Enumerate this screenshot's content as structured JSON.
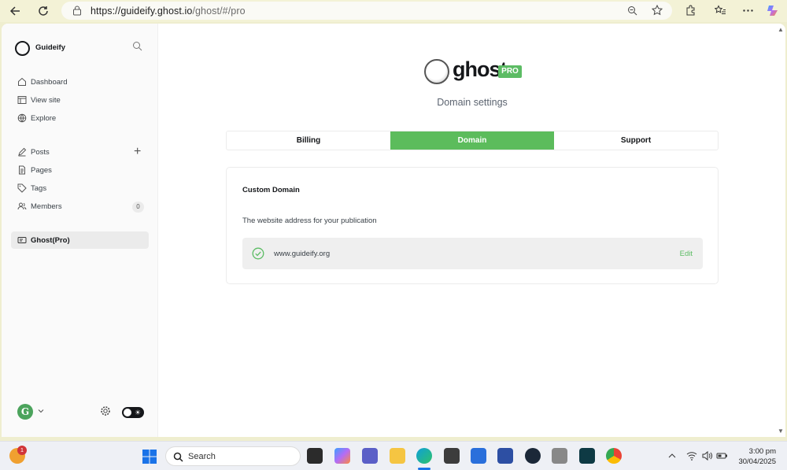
{
  "browser": {
    "url_host": "https://guideify.ghost.io",
    "url_path": "/ghost/#/pro"
  },
  "sidebar": {
    "site_name": "Guideify",
    "nav": [
      {
        "label": "Dashboard",
        "icon": "home-icon"
      },
      {
        "label": "View site",
        "icon": "layout-icon"
      },
      {
        "label": "Explore",
        "icon": "globe-icon"
      }
    ],
    "content": [
      {
        "label": "Posts",
        "icon": "edit-icon"
      },
      {
        "label": "Pages",
        "icon": "page-icon"
      },
      {
        "label": "Tags",
        "icon": "tag-icon"
      },
      {
        "label": "Members",
        "icon": "members-icon",
        "count": "0"
      }
    ],
    "pro_label": "Ghost(Pro)",
    "avatar_letter": "G"
  },
  "main": {
    "logo_text": "ghost",
    "logo_badge": "PRO",
    "subtitle": "Domain settings",
    "tabs": [
      {
        "label": "Billing",
        "active": false
      },
      {
        "label": "Domain",
        "active": true
      },
      {
        "label": "Support",
        "active": false
      }
    ],
    "card": {
      "title": "Custom Domain",
      "description": "The website address for your publication",
      "domain": "www.guideify.org",
      "edit_label": "Edit"
    }
  },
  "taskbar": {
    "search_label": "Search",
    "time": "3:00 pm",
    "date": "30/04/2025",
    "notification_count": "1"
  },
  "colors": {
    "accent_green": "#5cbc5c",
    "text_dark": "#15171a"
  }
}
